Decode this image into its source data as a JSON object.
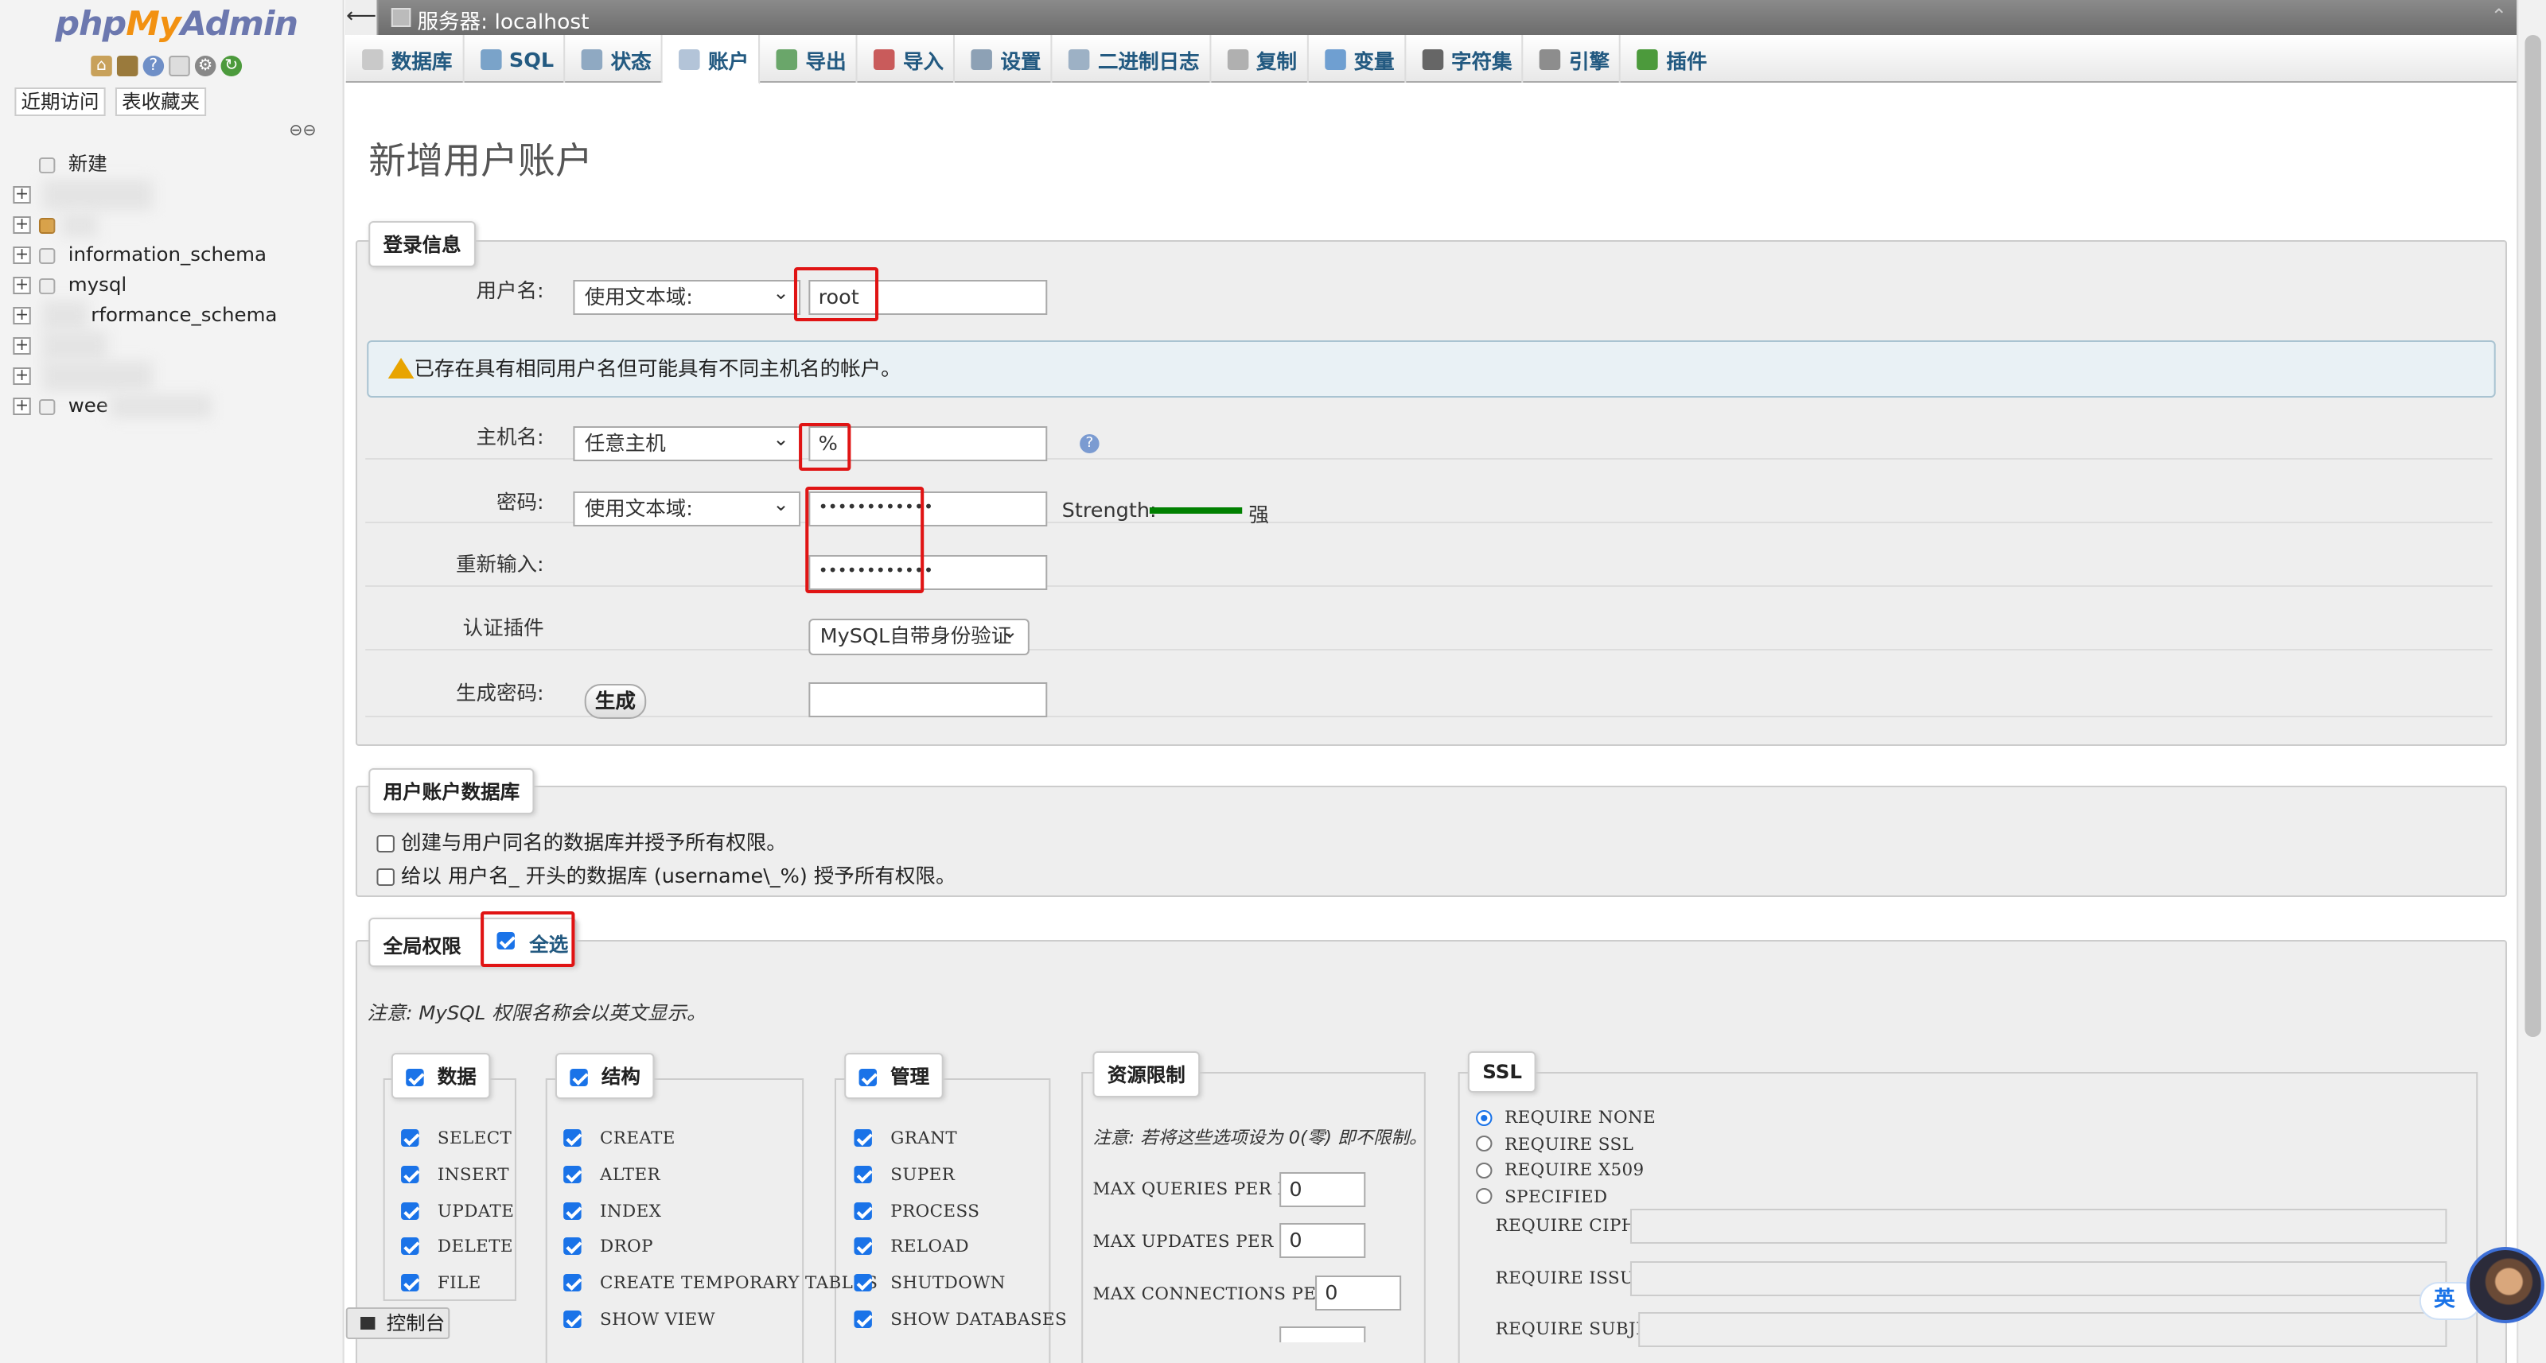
{
  "sidebar": {
    "logo": {
      "php": "php",
      "my": "My",
      "admin": "Admin"
    },
    "quick_icons": [
      "home-icon",
      "database-icon",
      "help-icon",
      "document-icon",
      "settings-icon",
      "reload-icon"
    ],
    "tabs": [
      "近期访问",
      "表收藏夹"
    ],
    "tree": [
      {
        "label": "新建",
        "blurred": false
      },
      {
        "label": "",
        "blurred": true
      },
      {
        "label": "",
        "blurred": true
      },
      {
        "label": "information_schema",
        "blurred": false
      },
      {
        "label": "mysql",
        "blurred": false
      },
      {
        "label": "rformance_schema",
        "blurred": false
      },
      {
        "label": "",
        "blurred": true
      },
      {
        "label": "",
        "blurred": true
      },
      {
        "label": "wee",
        "blurred": false
      }
    ]
  },
  "titlebar": {
    "server": "服务器: localhost"
  },
  "menu": [
    {
      "label": "数据库",
      "icon": "database-icon",
      "color": "#c9c9c9"
    },
    {
      "label": "SQL",
      "icon": "sql-icon",
      "color": "#7aa3c9"
    },
    {
      "label": "状态",
      "icon": "status-icon",
      "color": "#8fa9c2"
    },
    {
      "label": "账户",
      "icon": "accounts-icon",
      "color": "#b3c4d8"
    },
    {
      "label": "导出",
      "icon": "export-icon",
      "color": "#6aa66a"
    },
    {
      "label": "导入",
      "icon": "import-icon",
      "color": "#c95b5b"
    },
    {
      "label": "设置",
      "icon": "wrench-icon",
      "color": "#8da1b5"
    },
    {
      "label": "二进制日志",
      "icon": "binlog-icon",
      "color": "#9db1c5"
    },
    {
      "label": "复制",
      "icon": "replication-icon",
      "color": "#b0b0b0"
    },
    {
      "label": "变量",
      "icon": "variables-icon",
      "color": "#6f9fd1"
    },
    {
      "label": "字符集",
      "icon": "charset-icon",
      "color": "#666666"
    },
    {
      "label": "引擎",
      "icon": "engine-icon",
      "color": "#8d8d8d"
    },
    {
      "label": "插件",
      "icon": "plugin-icon",
      "color": "#4c9a3c"
    }
  ],
  "page_title": "新增用户账户",
  "login": {
    "legend": "登录信息",
    "username_label": "用户名:",
    "username_type": "使用文本域:",
    "username_value": "root",
    "warning": "已存在具有相同用户名但可能具有不同主机名的帐户。",
    "host_label": "主机名:",
    "host_type": "任意主机",
    "host_value": "%",
    "password_label": "密码:",
    "password_type": "使用文本域:",
    "password_value": "••••••••••••",
    "strength_label": "Strength:",
    "strength_value": "强",
    "retype_label": "重新输入:",
    "retype_value": "••••••••••••",
    "auth_label": "认证插件",
    "auth_value": "MySQL自带身份验证",
    "gen_label": "生成密码:",
    "gen_button": "生成"
  },
  "userdb": {
    "legend": "用户账户数据库",
    "opt1": "创建与用户同名的数据库并授予所有权限。",
    "opt2": "给以 用户名_ 开头的数据库 (username\\_%) 授予所有权限。"
  },
  "global": {
    "legend": "全局权限",
    "select_all": "全选",
    "note": "注意: MySQL 权限名称会以英文显示。",
    "data": {
      "legend": "数据",
      "items": [
        "SELECT",
        "INSERT",
        "UPDATE",
        "DELETE",
        "FILE"
      ]
    },
    "structure": {
      "legend": "结构",
      "items": [
        "CREATE",
        "ALTER",
        "INDEX",
        "DROP",
        "CREATE TEMPORARY TABLES",
        "SHOW VIEW"
      ]
    },
    "admin": {
      "legend": "管理",
      "items": [
        "GRANT",
        "SUPER",
        "PROCESS",
        "RELOAD",
        "SHUTDOWN",
        "SHOW DATABASES"
      ]
    },
    "resource": {
      "legend": "资源限制",
      "note": "注意: 若将这些选项设为 0(零) 即不限制。",
      "items": [
        {
          "label": "MAX QUERIES PER HOUR",
          "value": "0"
        },
        {
          "label": "MAX UPDATES PER HOUR",
          "value": "0"
        },
        {
          "label": "MAX CONNECTIONS PER HOUR",
          "value": "0"
        }
      ]
    },
    "ssl": {
      "legend": "SSL",
      "options": [
        "REQUIRE NONE",
        "REQUIRE SSL",
        "REQUIRE X509",
        "SPECIFIED"
      ],
      "fields": [
        "REQUIRE CIPHER",
        "REQUIRE ISSUER",
        "REQUIRE SUBJECT"
      ]
    }
  },
  "console": "控制台",
  "ime": "英",
  "colors": {
    "accent": "#235a81",
    "highlight": "#e01414",
    "strength": "#008000"
  }
}
